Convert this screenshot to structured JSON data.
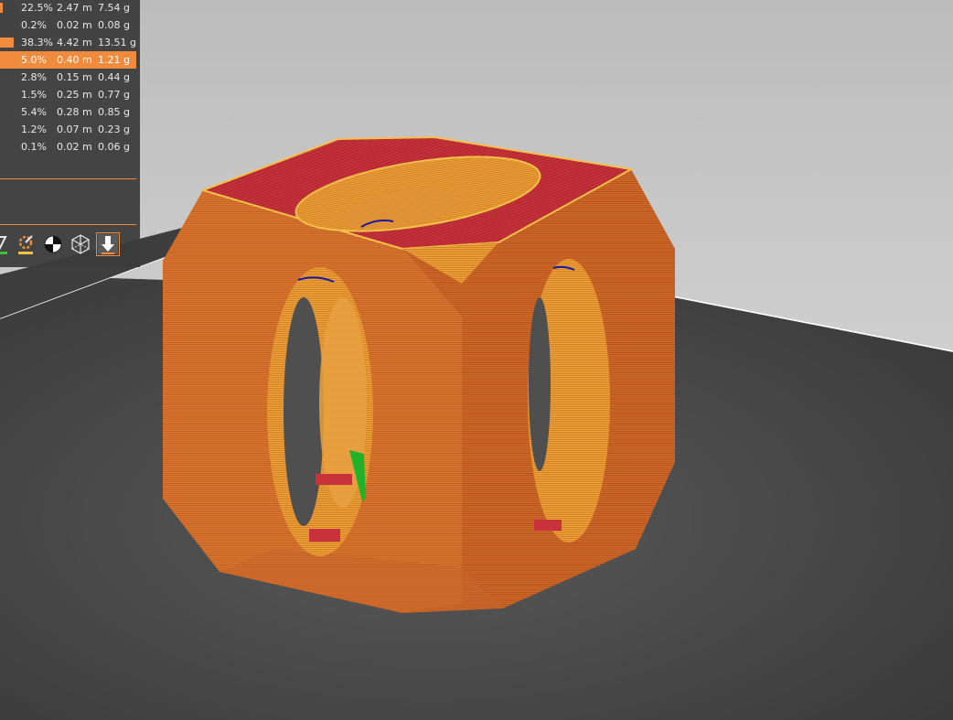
{
  "legend": {
    "rows": [
      {
        "percent": "22.5%",
        "length": "2.47 m",
        "weight": "7.54 g",
        "bar_fraction": 0.02
      },
      {
        "percent": "0.2%",
        "length": "0.02 m",
        "weight": "0.08 g",
        "bar_fraction": 0
      },
      {
        "percent": "38.3%",
        "length": "4.42 m",
        "weight": "13.51 g",
        "bar_fraction": 0.1
      },
      {
        "percent": "5.0%",
        "length": "0.40 m",
        "weight": "1.21 g",
        "bar_fraction": 0,
        "selected": true
      },
      {
        "percent": "2.8%",
        "length": "0.15 m",
        "weight": "0.44 g",
        "bar_fraction": 0
      },
      {
        "percent": "1.5%",
        "length": "0.25 m",
        "weight": "0.77 g",
        "bar_fraction": 0
      },
      {
        "percent": "5.4%",
        "length": "0.28 m",
        "weight": "0.85 g",
        "bar_fraction": 0
      },
      {
        "percent": "1.2%",
        "length": "0.07 m",
        "weight": "0.23 g",
        "bar_fraction": 0
      },
      {
        "percent": "0.1%",
        "length": "0.02 m",
        "weight": "0.06 g",
        "bar_fraction": 0
      }
    ]
  },
  "toolbar": {
    "buttons": [
      {
        "icon": "legend-toggle-icon"
      },
      {
        "icon": "tool-change-icon"
      },
      {
        "icon": "center-of-mass-icon"
      },
      {
        "icon": "bounding-box-icon"
      },
      {
        "icon": "export-toolpaths-icon",
        "active": true
      }
    ]
  },
  "colors": {
    "accent": "#f08a3c",
    "perimeter": "#e07030",
    "top_surface": "#c8323a",
    "inner": "#f2a33a",
    "wipe": "#22b22a",
    "retract": "#1a1aa0",
    "bed": "#4a4a4a",
    "sky_top": "#b8b8b8"
  }
}
